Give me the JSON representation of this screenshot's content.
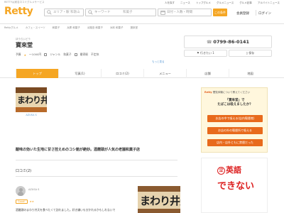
{
  "header": {
    "tagline": "RETTYは実名口コミグルメサービス",
    "logo": "Retty",
    "top_links": [
      "人を探す",
      "ニュース",
      "トップグルメ",
      "グルメニュース",
      "グルメ記事",
      "アルバイトニュース"
    ],
    "area_placeholder": "エリア・駅",
    "area_value": "和歌山",
    "keyword_placeholder": "キーワード",
    "keyword_value": "和菓子",
    "date_placeholder": "日付・人数・時間",
    "search_label": "この条件",
    "register_label": "会員登録",
    "login_label": "ログイン"
  },
  "breadcrumb": [
    "Rettyグルメ",
    "カフェ・スイーツ",
    "和菓子",
    "兵庫 和菓子",
    "淡路島 和菓子",
    "洲本 和菓子",
    "寶來堂"
  ],
  "restaurant": {
    "furigana": "ほうらいどう",
    "name": "寶來堂",
    "rating": "予算",
    "stars": "★",
    "budget": "〜1000円",
    "genre_label": "ジャンル",
    "genre": "和菓子",
    "station_label": "最寄駅",
    "station": "不定休",
    "more_link": "もっと見る"
  },
  "contact": {
    "phone": "0799-86-0141",
    "want_label": "行きたい",
    "want_count": "1",
    "save_label": "保存"
  },
  "tabs": [
    "トップ",
    "写真(1)",
    "口コミ(2)",
    "メニュー",
    "店舗",
    "地図"
  ],
  "photo": {
    "sign_text": "まわり井",
    "caption": "AZUSA S"
  },
  "description": "酸味の効いた生地に甘さ控えめのコシ餡が絶妙。酒饅頭が人気の老舗和菓子店",
  "reviews": {
    "heading": "口コミ(2)",
    "items": [
      {
        "author": "AZUSA S",
        "label": "Good!",
        "stars": "★★",
        "text": "酒饅頭のまわり井天を食べたくて訪れました。好き嫌いも分かれるかもしれないで",
        "photo_text": "まわり井天"
      }
    ]
  },
  "ad": {
    "brand": "Retty",
    "header": "閲覧体験について教えてください",
    "question": "「寶來堂」で\nたばこは吸えましたか？",
    "options": [
      "お店の中で吸える(店内喫煙席)",
      "お店の外の喫煙所で吸える",
      "店内・店外ともに禁煙だった"
    ]
  },
  "ad2": {
    "line1_circle": "泣",
    "line1_text": "英語",
    "line2_text": "できない"
  }
}
